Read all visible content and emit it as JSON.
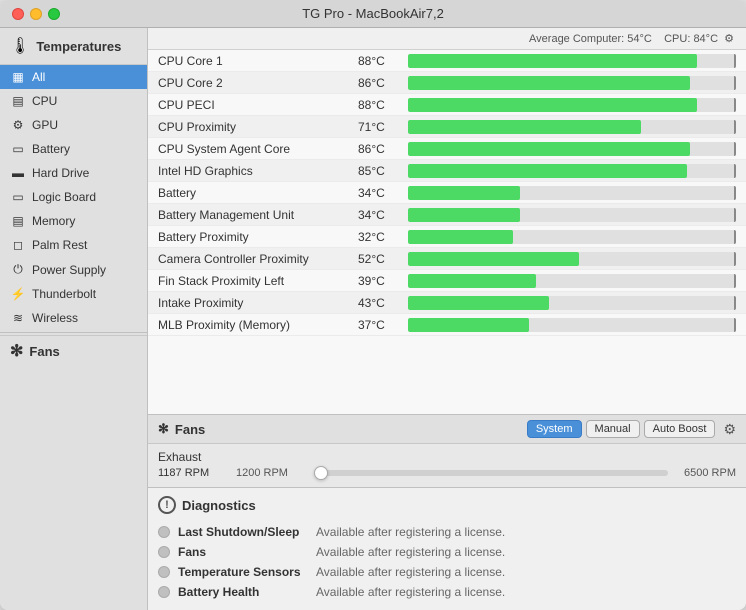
{
  "window": {
    "title": "TG Pro - MacBookAir7,2"
  },
  "header_stats": {
    "average_label": "Average Computer:",
    "average_value": "54°C",
    "cpu_label": "CPU:",
    "cpu_value": "84°C"
  },
  "sidebar": {
    "header_icon": "🌡",
    "header_label": "Temperatures",
    "items": [
      {
        "id": "all",
        "label": "All",
        "icon": "▦",
        "active": true
      },
      {
        "id": "cpu",
        "label": "CPU",
        "icon": "▤"
      },
      {
        "id": "gpu",
        "label": "GPU",
        "icon": "⚙"
      },
      {
        "id": "battery",
        "label": "Battery",
        "icon": "🔋"
      },
      {
        "id": "harddrive",
        "label": "Hard Drive",
        "icon": "🖥"
      },
      {
        "id": "logicboard",
        "label": "Logic Board",
        "icon": "📋"
      },
      {
        "id": "memory",
        "label": "Memory",
        "icon": "▦"
      },
      {
        "id": "palmrest",
        "label": "Palm Rest",
        "icon": "✋"
      },
      {
        "id": "powersupply",
        "label": "Power Supply",
        "icon": "⚡"
      },
      {
        "id": "thunderbolt",
        "label": "Thunderbolt",
        "icon": "⚡"
      },
      {
        "id": "wireless",
        "label": "Wireless",
        "icon": "📶"
      }
    ],
    "fans_header": "Fans",
    "fans_icon": "❄"
  },
  "temperatures": [
    {
      "name": "CPU Core 1",
      "value": "88°C",
      "bar_pct": 88
    },
    {
      "name": "CPU Core 2",
      "value": "86°C",
      "bar_pct": 86
    },
    {
      "name": "CPU PECI",
      "value": "88°C",
      "bar_pct": 88
    },
    {
      "name": "CPU Proximity",
      "value": "71°C",
      "bar_pct": 71
    },
    {
      "name": "CPU System Agent Core",
      "value": "86°C",
      "bar_pct": 86
    },
    {
      "name": "Intel HD Graphics",
      "value": "85°C",
      "bar_pct": 85
    },
    {
      "name": "Battery",
      "value": "34°C",
      "bar_pct": 34
    },
    {
      "name": "Battery Management Unit",
      "value": "34°C",
      "bar_pct": 34
    },
    {
      "name": "Battery Proximity",
      "value": "32°C",
      "bar_pct": 32
    },
    {
      "name": "Camera Controller Proximity",
      "value": "52°C",
      "bar_pct": 52
    },
    {
      "name": "Fin Stack Proximity Left",
      "value": "39°C",
      "bar_pct": 39
    },
    {
      "name": "Intake Proximity",
      "value": "43°C",
      "bar_pct": 43
    },
    {
      "name": "MLB Proximity (Memory)",
      "value": "37°C",
      "bar_pct": 37
    }
  ],
  "fans": {
    "header_label": "Fans",
    "header_icon": "❄",
    "buttons": [
      {
        "id": "system",
        "label": "System",
        "active": true
      },
      {
        "id": "manual",
        "label": "Manual",
        "active": false
      },
      {
        "id": "autoboost",
        "label": "Auto Boost",
        "active": false
      }
    ],
    "fan_items": [
      {
        "name": "Exhaust",
        "current_rpm": "1187 RPM",
        "min_rpm": "1200 RPM",
        "max_rpm": "6500 RPM",
        "slider_pct": 2
      }
    ]
  },
  "diagnostics": {
    "header_label": "Diagnostics",
    "rows": [
      {
        "label": "Last Shutdown/Sleep",
        "value": "Available after registering a license."
      },
      {
        "label": "Fans",
        "value": "Available after registering a license."
      },
      {
        "label": "Temperature Sensors",
        "value": "Available after registering a license."
      },
      {
        "label": "Battery Health",
        "value": "Available after registering a license."
      }
    ]
  }
}
